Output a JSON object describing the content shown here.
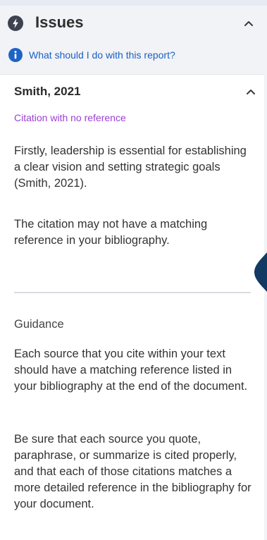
{
  "header": {
    "title": "Issues",
    "icon": "lightning-bolt-icon"
  },
  "help": {
    "link_label": "What should I do with this report?",
    "icon": "info-icon"
  },
  "issue": {
    "title": "Smith, 2021",
    "type": "Citation with no reference",
    "excerpt": "Firstly, leadership is essential for establishing a clear vision and setting strategic goals (Smith, 2021).",
    "explanation": "The citation may not have a matching reference in your bibliography.",
    "guidance_title": "Guidance",
    "guidance_paragraphs": [
      "Each source that you cite within your text should have a matching reference listed in your bibliography at the end of the document.",
      "Be sure that each source you quote, paraphrase, or summarize is cited properly, and that each of those citations matches a more detailed reference in the bibliography for your document."
    ]
  },
  "colors": {
    "accent_link": "#1a5fc4",
    "issue_type": "#9b3fd6",
    "side_tab": "#123a63"
  }
}
